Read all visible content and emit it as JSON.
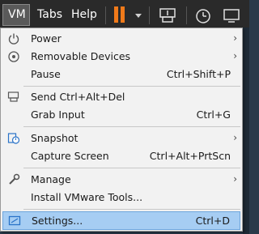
{
  "menubar": {
    "vm_label": "VM",
    "tabs_label": "Tabs",
    "help_label": "Help"
  },
  "menu": {
    "power": "Power",
    "removable_devices": "Removable Devices",
    "pause": "Pause",
    "pause_shortcut": "Ctrl+Shift+P",
    "send_cad": "Send Ctrl+Alt+Del",
    "grab_input": "Grab Input",
    "grab_input_shortcut": "Ctrl+G",
    "snapshot": "Snapshot",
    "capture_screen": "Capture Screen",
    "capture_screen_shortcut": "Ctrl+Alt+PrtScn",
    "manage": "Manage",
    "install_tools": "Install VMware Tools...",
    "settings": "Settings...",
    "settings_shortcut": "Ctrl+D",
    "submenu_arrow": "›"
  },
  "colors": {
    "menubar_bg": "#2a2a2a",
    "menu_bg": "#f2f2f2",
    "highlight": "#a6cdf3",
    "pause_accent": "#f07a1a"
  },
  "icons": [
    "power-icon",
    "removable-devices-icon",
    "send-cad-icon",
    "snapshot-icon",
    "manage-wrench-icon",
    "settings-icon",
    "pause-icon",
    "send-keys-toolbar-icon",
    "snapshot-clock-toolbar-icon",
    "fullscreen-toolbar-icon"
  ]
}
